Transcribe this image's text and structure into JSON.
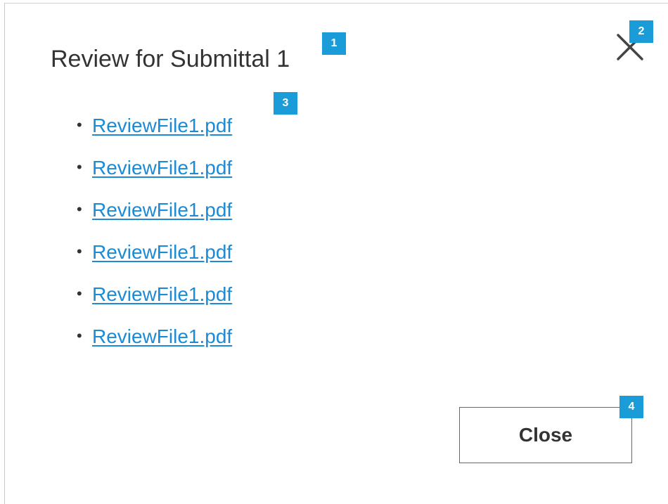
{
  "dialog": {
    "title": "Review for Submittal 1",
    "close_icon": "close-icon",
    "files": [
      {
        "name": "ReviewFile1.pdf"
      },
      {
        "name": "ReviewFile1.pdf"
      },
      {
        "name": "ReviewFile1.pdf"
      },
      {
        "name": "ReviewFile1.pdf"
      },
      {
        "name": "ReviewFile1.pdf"
      },
      {
        "name": "ReviewFile1.pdf"
      }
    ],
    "close_button_label": "Close"
  },
  "annotations": {
    "badge_1": "1",
    "badge_2": "2",
    "badge_3": "3",
    "badge_4": "4"
  },
  "colors": {
    "link": "#1c8ad4",
    "badge": "#1a9cd8",
    "text": "#333333"
  }
}
